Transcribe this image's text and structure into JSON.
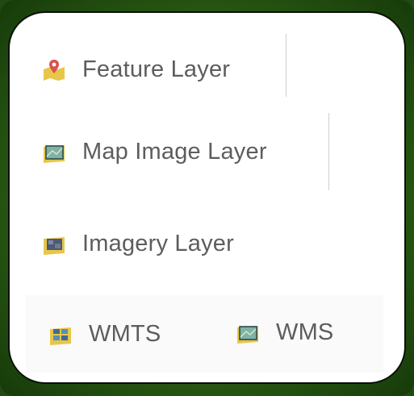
{
  "layers": {
    "feature": {
      "label": "Feature Layer",
      "icon": "feature-layer-icon"
    },
    "map_image": {
      "label": "Map Image Layer",
      "icon": "map-image-layer-icon"
    },
    "imagery": {
      "label": "Imagery Layer",
      "icon": "imagery-layer-icon"
    },
    "wmts": {
      "label": "WMTS",
      "icon": "wmts-layer-icon"
    },
    "wms": {
      "label": "WMS",
      "icon": "wms-layer-icon"
    }
  },
  "colors": {
    "frame": "#2c5e14",
    "card": "#ffffff",
    "text": "#5d5d5d",
    "icon_base": "#e7c64a",
    "icon_pin": "#d9534f",
    "icon_map": "#7fb3a6"
  }
}
